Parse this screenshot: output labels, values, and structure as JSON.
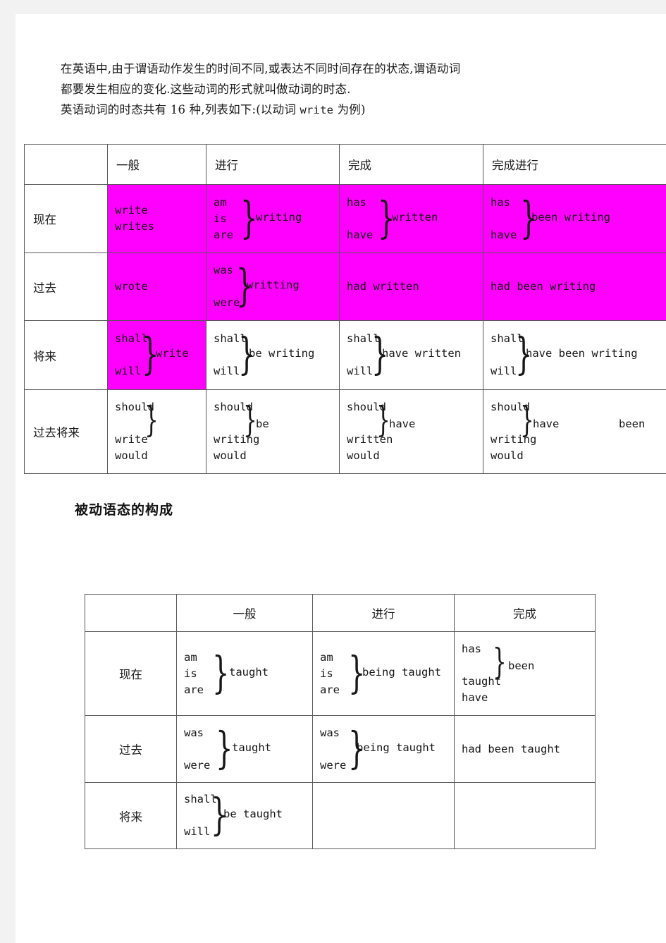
{
  "intro": {
    "line1": "在英语中,由于谓语动作发生的时间不同,或表达不同时间存在的状态,谓语动词",
    "line2": "都要发生相应的变化.这些动词的形式就叫做动词的时态.",
    "line3_a": "英语动词的时态共有 16 种,列表如下:(以动词 ",
    "line3_verb": "write",
    "line3_b": " 为例)"
  },
  "section_title": "被动语态的构成",
  "colors": {
    "highlight": "#ff00ff",
    "border": "#585858",
    "text": "#171717",
    "page_background": "#ffffff",
    "canvas_background": "#f2f2f2"
  },
  "active_table": {
    "corner": "",
    "headers": [
      "一般",
      "进行",
      "完成",
      "完成进行"
    ],
    "rows": [
      {
        "label": "现在",
        "cells": [
          {
            "kind": "plain",
            "lines": [
              "write",
              "writes"
            ],
            "highlight": true
          },
          {
            "kind": "brace",
            "top": "am",
            "mid": "is",
            "bottom": "are",
            "result": "writing",
            "highlight": true
          },
          {
            "kind": "brace",
            "top": "has",
            "mid": "",
            "bottom": "have",
            "result": "written",
            "highlight": true
          },
          {
            "kind": "brace",
            "top": "has",
            "mid": "",
            "bottom": "have",
            "result": "been writing",
            "highlight": true
          }
        ]
      },
      {
        "label": "过去",
        "cells": [
          {
            "kind": "plain",
            "lines": [
              "wrote"
            ],
            "highlight": true
          },
          {
            "kind": "brace",
            "top": "was",
            "mid": "",
            "bottom": "were",
            "result": "writting",
            "highlight": true
          },
          {
            "kind": "plain",
            "lines": [
              "had written"
            ],
            "highlight": true
          },
          {
            "kind": "plain",
            "lines": [
              "had been writing"
            ],
            "highlight": true
          }
        ]
      },
      {
        "label": "将来",
        "cells": [
          {
            "kind": "brace",
            "top": "shall",
            "mid": "",
            "bottom": "will",
            "result": "write",
            "highlight": true
          },
          {
            "kind": "brace",
            "top": "shall",
            "mid": "",
            "bottom": "will",
            "result": "be writing",
            "highlight": false
          },
          {
            "kind": "brace",
            "top": "shall",
            "mid": "",
            "bottom": "will",
            "result": "have written",
            "highlight": false
          },
          {
            "kind": "brace",
            "top": "shall",
            "mid": "",
            "bottom": "will",
            "result": "have been writing",
            "highlight": false
          }
        ]
      },
      {
        "label": "过去将来",
        "cells": [
          {
            "kind": "brace4",
            "top": "should",
            "result": "",
            "tail1": "write",
            "tail2": "would",
            "highlight": false
          },
          {
            "kind": "brace4",
            "top": "should",
            "result": "be",
            "tail1": "writing",
            "tail2": "would",
            "highlight": false
          },
          {
            "kind": "brace4",
            "top": "should",
            "result": "have",
            "tail1": "written",
            "tail2": "would",
            "highlight": false
          },
          {
            "kind": "brace4",
            "top": "should",
            "result": "have",
            "result_far": "been",
            "tail1": "writing",
            "tail2": "would",
            "highlight": false
          }
        ]
      }
    ]
  },
  "passive_table": {
    "corner": "",
    "headers": [
      "一般",
      "进行",
      "完成"
    ],
    "rows": [
      {
        "label": "现在",
        "cells": [
          {
            "kind": "brace",
            "top": "am",
            "mid": "is",
            "bottom": "are",
            "result": "taught"
          },
          {
            "kind": "brace",
            "top": "am",
            "mid": "is",
            "bottom": "are",
            "result": "being taught"
          },
          {
            "kind": "brace4",
            "top": "has",
            "result": "been",
            "tail1": "taught",
            "tail2": "have"
          }
        ]
      },
      {
        "label": "过去",
        "cells": [
          {
            "kind": "brace",
            "top": "was",
            "mid": "",
            "bottom": "were",
            "result": "taught"
          },
          {
            "kind": "brace",
            "top": "was",
            "mid": "",
            "bottom": "were",
            "result": "being taught"
          },
          {
            "kind": "plain",
            "lines": [
              "had been taught"
            ]
          }
        ]
      },
      {
        "label": "将来",
        "cells": [
          {
            "kind": "brace",
            "top": "shall",
            "mid": "",
            "bottom": "will",
            "result": "be taught"
          },
          {
            "kind": "empty"
          },
          {
            "kind": "empty"
          }
        ]
      }
    ]
  }
}
